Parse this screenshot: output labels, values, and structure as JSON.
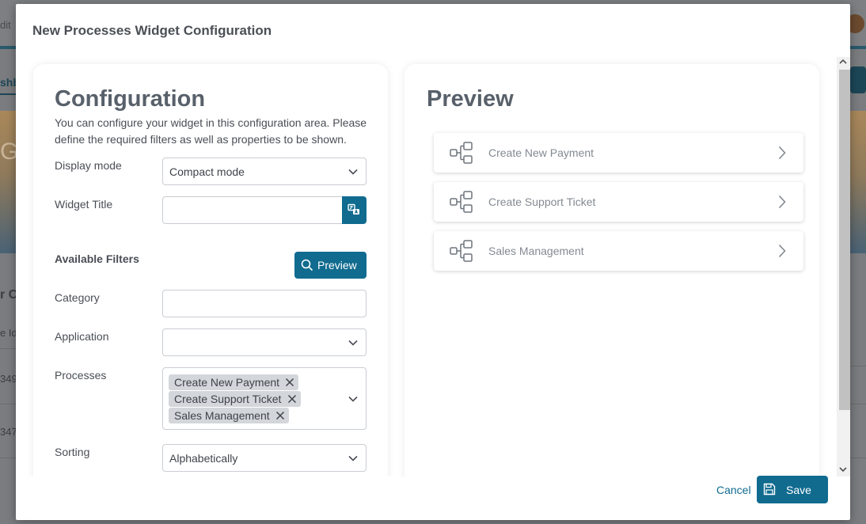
{
  "background": {
    "edit_text": "dit",
    "tab_text": "shb",
    "banner_text": "G",
    "side_label": "r C",
    "id_label": "e Id",
    "row1": "349",
    "row2": "347"
  },
  "dialog": {
    "title": "New Processes Widget Configuration"
  },
  "config": {
    "heading": "Configuration",
    "description": "You can configure your widget in this configuration area. Please define the required filters as well as properties to be shown.",
    "display_mode_label": "Display mode",
    "display_mode_value": "Compact mode",
    "widget_title_label": "Widget Title",
    "widget_title_value": "",
    "available_filters_label": "Available Filters",
    "preview_button": "Preview",
    "category_label": "Category",
    "category_value": "",
    "application_label": "Application",
    "application_value": "",
    "processes_label": "Processes",
    "processes_selected": [
      "Create New Payment",
      "Create Support Ticket",
      "Sales Management"
    ],
    "sorting_label": "Sorting",
    "sorting_value": "Alphabetically"
  },
  "preview": {
    "heading": "Preview",
    "items": [
      "Create New Payment",
      "Create Support Ticket",
      "Sales Management"
    ]
  },
  "footer": {
    "cancel": "Cancel",
    "save": "Save"
  },
  "colors": {
    "accent": "#106b8f",
    "heading": "#58606a",
    "chip": "#d3d6da"
  },
  "icons": {
    "translate": "translate-icon",
    "search": "search-icon",
    "process": "process-flow-icon",
    "chevron": "chevron-right-icon",
    "save": "floppy-disk-icon",
    "remove": "close-icon",
    "dropdown": "chevron-down-icon"
  }
}
